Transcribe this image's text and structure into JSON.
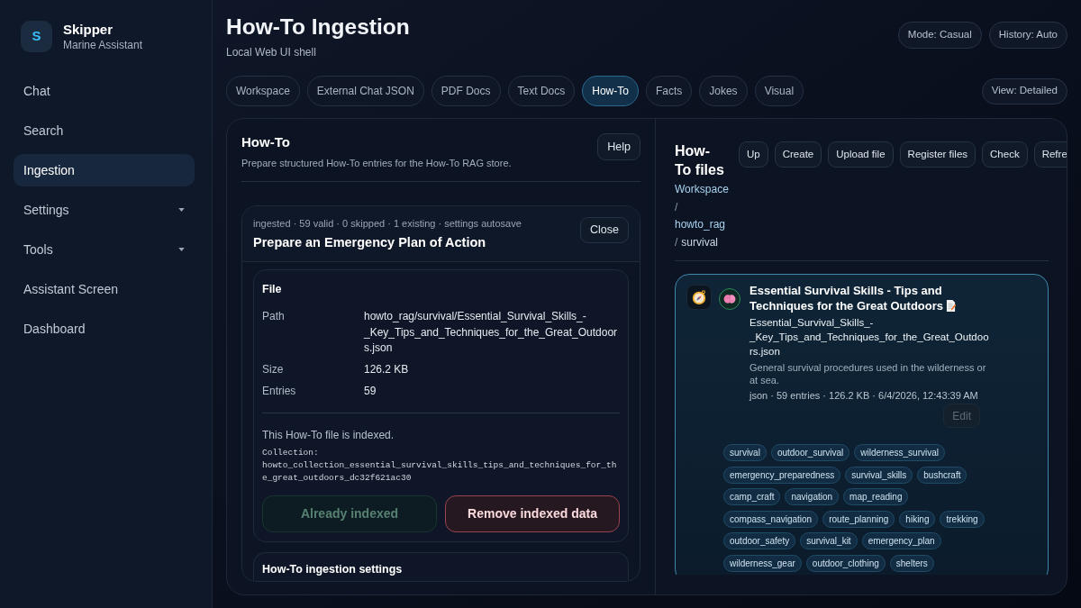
{
  "sidebar": {
    "logo_letter": "S",
    "app_name": "Skipper",
    "app_subtitle": "Marine Assistant",
    "items": [
      {
        "label": "Chat",
        "selected": false,
        "submenu": false
      },
      {
        "label": "Search",
        "selected": false,
        "submenu": false
      },
      {
        "label": "Ingestion",
        "selected": true,
        "submenu": false
      },
      {
        "label": "Settings",
        "selected": false,
        "submenu": true
      },
      {
        "label": "Tools",
        "selected": false,
        "submenu": true
      },
      {
        "label": "Assistant Screen",
        "selected": false,
        "submenu": false
      },
      {
        "label": "Dashboard",
        "selected": false,
        "submenu": false
      }
    ]
  },
  "header": {
    "title": "How-To Ingestion",
    "subtitle": "Local Web UI shell",
    "toggles": [
      "Mode: Casual",
      "History: Auto"
    ]
  },
  "tabs": [
    {
      "label": "Workspace",
      "selected": false
    },
    {
      "label": "External Chat JSON",
      "selected": false
    },
    {
      "label": "PDF Docs",
      "selected": false
    },
    {
      "label": "Text Docs",
      "selected": false
    },
    {
      "label": "How-To",
      "selected": true
    },
    {
      "label": "Facts",
      "selected": false
    },
    {
      "label": "Jokes",
      "selected": false
    },
    {
      "label": "Visual",
      "selected": false
    }
  ],
  "view_button": "View: Detailed",
  "howto_panel": {
    "title": "How-To",
    "subtitle": "Prepare structured How-To entries for the How-To RAG store.",
    "help_button": "Help",
    "entry_card": {
      "status": "ingested · 59 valid · 0 skipped · 1 existing · settings autosave",
      "title": "Prepare an Emergency Plan of Action",
      "close_button": "Close",
      "file": {
        "heading": "File",
        "rows": [
          {
            "label": "Path",
            "value": "howto_rag/survival/Essential_Survival_Skills_-_Key_Tips_and_Techniques_for_the_Great_Outdoors.json"
          },
          {
            "label": "Size",
            "value": "126.2 KB"
          },
          {
            "label": "Entries",
            "value": "59"
          }
        ],
        "index_status": "This How-To file is indexed.",
        "collection": "Collection: howto_collection_essential_survival_skills_tips_and_techniques_for_the_great_outdoors_dc32f621ac30",
        "actions": [
          {
            "label": "Already indexed",
            "kind": "success",
            "disabled": true
          },
          {
            "label": "Remove indexed data",
            "kind": "danger",
            "disabled": false
          }
        ]
      },
      "settings_heading": "How-To ingestion settings"
    }
  },
  "files_panel": {
    "title": "How-To files",
    "breadcrumb": [
      {
        "label": "Workspace",
        "kind": "link"
      },
      {
        "label": "/",
        "kind": "separator"
      },
      {
        "label": "howto_rag",
        "kind": "link"
      },
      {
        "label": "/",
        "kind": "separator"
      },
      {
        "label": "survival",
        "kind": "current"
      }
    ],
    "toolbar": [
      {
        "label": "Up",
        "clipped": false
      },
      {
        "label": "Create",
        "clipped": false
      },
      {
        "label": "Upload file",
        "clipped": false
      },
      {
        "label": "Register files",
        "clipped": false
      },
      {
        "label": "Check",
        "clipped": false
      },
      {
        "label": "Refre",
        "clipped": true
      }
    ],
    "file_card": {
      "selected": true,
      "title": "Essential Survival Skills - Tips and Techniques for the Great Outdoors",
      "file_name": "Essential_Survival_Skills_-_Key_Tips_and_Techniques_for_the_Great_Outdoors.json",
      "description": "General survival procedures used in the wilderness or at sea.",
      "meta": "json · 59 entries · 126.2 KB · 6/4/2026, 12:43:39 AM",
      "edit_button": {
        "label": "Edit",
        "disabled": true
      },
      "tags": [
        "survival",
        "outdoor_survival",
        "wilderness_survival",
        "emergency_preparedness",
        "survival_skills",
        "bushcraft",
        "camp_craft",
        "navigation",
        "map_reading",
        "compass_navigation",
        "route_planning",
        "hiking",
        "trekking",
        "outdoor_safety",
        "survival_kit",
        "emergency_plan",
        "wilderness_gear",
        "outdoor_clothing",
        "shelters"
      ]
    }
  }
}
